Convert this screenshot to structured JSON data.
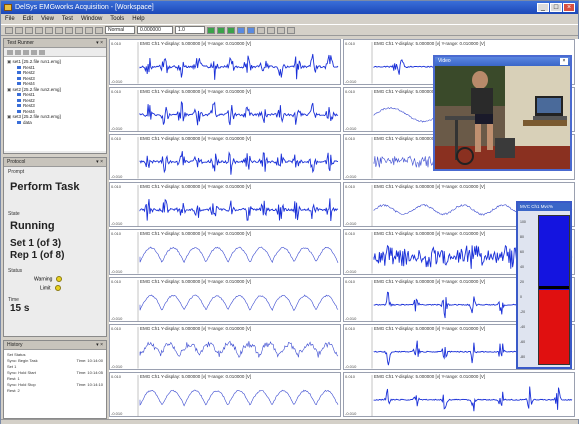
{
  "window": {
    "title": "DelSys EMGworks Acquisition - [Workspace]"
  },
  "menu": [
    "File",
    "Edit",
    "View",
    "Test",
    "Window",
    "Tools",
    "Help"
  ],
  "toolbar": {
    "combo1": "Normal",
    "combo2": "0.000000",
    "combo3": "1.0"
  },
  "tree_panel": {
    "title": "Test Runner",
    "items": [
      {
        "level": 1,
        "label": "set1 [25.2.file run1.emg]"
      },
      {
        "level": 2,
        "label": "Rest1"
      },
      {
        "level": 2,
        "label": "Rest2"
      },
      {
        "level": 2,
        "label": "Rest3"
      },
      {
        "level": 2,
        "label": "Rest4"
      },
      {
        "level": 1,
        "label": "set2 [25.2.file run2.emg]"
      },
      {
        "level": 2,
        "label": "Rest1"
      },
      {
        "level": 2,
        "label": "Rest2"
      },
      {
        "level": 2,
        "label": "Rest3"
      },
      {
        "level": 2,
        "label": "Rest4"
      },
      {
        "level": 1,
        "label": "set3 [25.2.file run3.emg]"
      },
      {
        "level": 2,
        "label": "data"
      }
    ]
  },
  "protocol_panel": {
    "title": "Protocol",
    "prompt_label": "Prompt",
    "prompt": "Perform Task",
    "state_label": "State",
    "state": "Running",
    "set": "Set 1 (of 3)",
    "rep": "Rep 1 (of 8)",
    "status_label": "Status",
    "status1": "Warning",
    "status2": "Limit",
    "time_label": "Time",
    "time": "15 s"
  },
  "history_panel": {
    "title": "History",
    "lines": [
      {
        "name": "Set Status",
        "value": ""
      },
      {
        "name": "Sync: Begin Task",
        "value": "Time: 10:14:00"
      },
      {
        "name": "Set 1",
        "value": ""
      },
      {
        "name": "Sync: Hold Start",
        "value": "Time: 10:14:05"
      },
      {
        "name": "Rest: 1",
        "value": ""
      },
      {
        "name": "Sync: Hold Stop",
        "value": "Time: 10:14:10"
      },
      {
        "name": "Rest: 2",
        "value": ""
      }
    ]
  },
  "channel_title": "EMG Ch1 Y-display: 5.000000 [v] Y-range: 0.010000 [V]",
  "channel_ymax": "0.010",
  "channel_ymin": "-0.010",
  "video": {
    "title": "Video"
  },
  "meter": {
    "title": "MVC Ch1 Mvc%",
    "ticks": [
      "100",
      "80",
      "60",
      "40",
      "20",
      "0",
      "-20",
      "-40",
      "-60",
      "-80"
    ],
    "level": 0.53
  }
}
